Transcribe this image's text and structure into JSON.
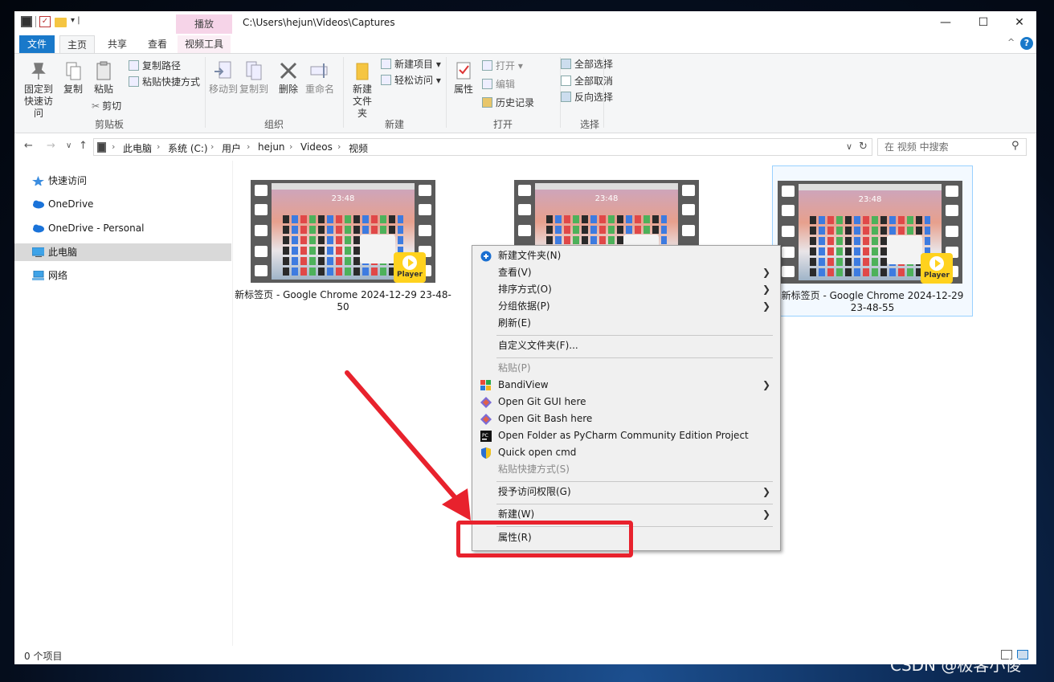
{
  "titlebar": {
    "path": "C:\\Users\\hejun\\Videos\\Captures",
    "context_tab": "播放"
  },
  "tabs": {
    "file": "文件",
    "home": "主页",
    "share": "共享",
    "view": "查看",
    "video_tools": "视频工具"
  },
  "ribbon": {
    "clipboard": {
      "label": "剪贴板",
      "pin": "固定到快速访问",
      "copy": "复制",
      "paste": "粘贴",
      "copy_path": "复制路径",
      "paste_shortcut": "粘贴快捷方式",
      "cut": "剪切"
    },
    "organize": {
      "label": "组织",
      "move_to": "移动到",
      "copy_to": "复制到",
      "delete": "删除",
      "rename": "重命名"
    },
    "new": {
      "label": "新建",
      "new_folder": "新建文件夹",
      "new_item": "新建项目 ▾",
      "easy_access": "轻松访问 ▾"
    },
    "open": {
      "label": "打开",
      "properties": "属性",
      "open": "打开 ▾",
      "edit": "编辑",
      "history": "历史记录"
    },
    "select": {
      "label": "选择",
      "select_all": "全部选择",
      "select_none": "全部取消",
      "invert": "反向选择"
    }
  },
  "address": {
    "crumbs": [
      "此电脑",
      "系统 (C:)",
      "用户",
      "hejun",
      "Videos",
      "视频"
    ],
    "search_placeholder": "在 视频 中搜索"
  },
  "navpane": {
    "items": [
      "快速访问",
      "OneDrive",
      "OneDrive - Personal",
      "此电脑",
      "网络"
    ]
  },
  "files": [
    {
      "name": "新标签页 - Google Chrome 2024-12-29 23-48-50",
      "thumb_time": "23:48",
      "badge": "Player"
    },
    {
      "name": "",
      "thumb_time": "23:48",
      "badge": ""
    },
    {
      "name": "新标签页 - Google Chrome 2024-12-29 23-48-55",
      "thumb_time": "23:48",
      "badge": "Player"
    }
  ],
  "status": {
    "count": "0 个项目"
  },
  "context_menu": {
    "items": [
      {
        "label": "新建文件夹(N)",
        "disabled": false
      },
      {
        "label": "查看(V)",
        "disabled": false
      },
      {
        "label": "排序方式(O)",
        "disabled": false
      },
      {
        "label": "分组依据(P)",
        "disabled": false
      },
      {
        "label": "刷新(E)",
        "disabled": false
      },
      {
        "label": "自定义文件夹(F)...",
        "disabled": false
      },
      {
        "label": "粘贴(P)",
        "disabled": true
      },
      {
        "label": "BandiView",
        "disabled": false
      },
      {
        "label": "Open Git GUI here",
        "disabled": false
      },
      {
        "label": "Open Git Bash here",
        "disabled": false
      },
      {
        "label": "Open Folder as PyCharm Community Edition Project",
        "disabled": false
      },
      {
        "label": "Quick open cmd",
        "disabled": false
      },
      {
        "label": "粘贴快捷方式(S)",
        "disabled": true
      },
      {
        "label": "授予访问权限(G)",
        "disabled": false
      },
      {
        "label": "新建(W)",
        "disabled": false
      },
      {
        "label": "属性(R)",
        "disabled": false
      }
    ],
    "submenu_arrow": "❯"
  },
  "watermark": "CSDN @极客小俊",
  "colors": {
    "accent": "#1979ca",
    "annotation": "#e8222d",
    "context_tab": "#f6d4e8"
  }
}
